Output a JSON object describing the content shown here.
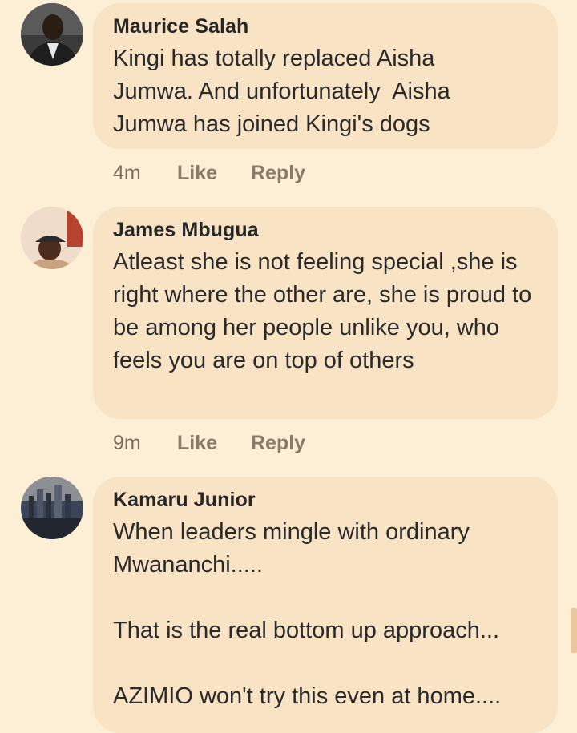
{
  "comments": [
    {
      "author": "Maurice Salah",
      "text": "Kingi has totally replaced Aisha Jumwa. And unfortunately  Aisha Jumwa has joined Kingi's dogs",
      "time": "4m",
      "like": "Like",
      "reply": "Reply"
    },
    {
      "author": "James Mbugua",
      "text": "Atleast she is not feeling special ,she is right where the other are, she is proud to be among her people unlike you, who feels you are on top of others",
      "time": "9m",
      "like": "Like",
      "reply": "Reply"
    },
    {
      "author": "Kamaru Junior",
      "text": "When leaders mingle with ordinary Mwananchi.....\n\nThat is the real bottom up approach...\n\nAZIMIO won't try this even at home....",
      "time": "",
      "like": "",
      "reply": ""
    }
  ],
  "colors": {
    "background": "#fdefd6",
    "bubble": "#f9e3c5",
    "meta": "#8a7a66"
  }
}
